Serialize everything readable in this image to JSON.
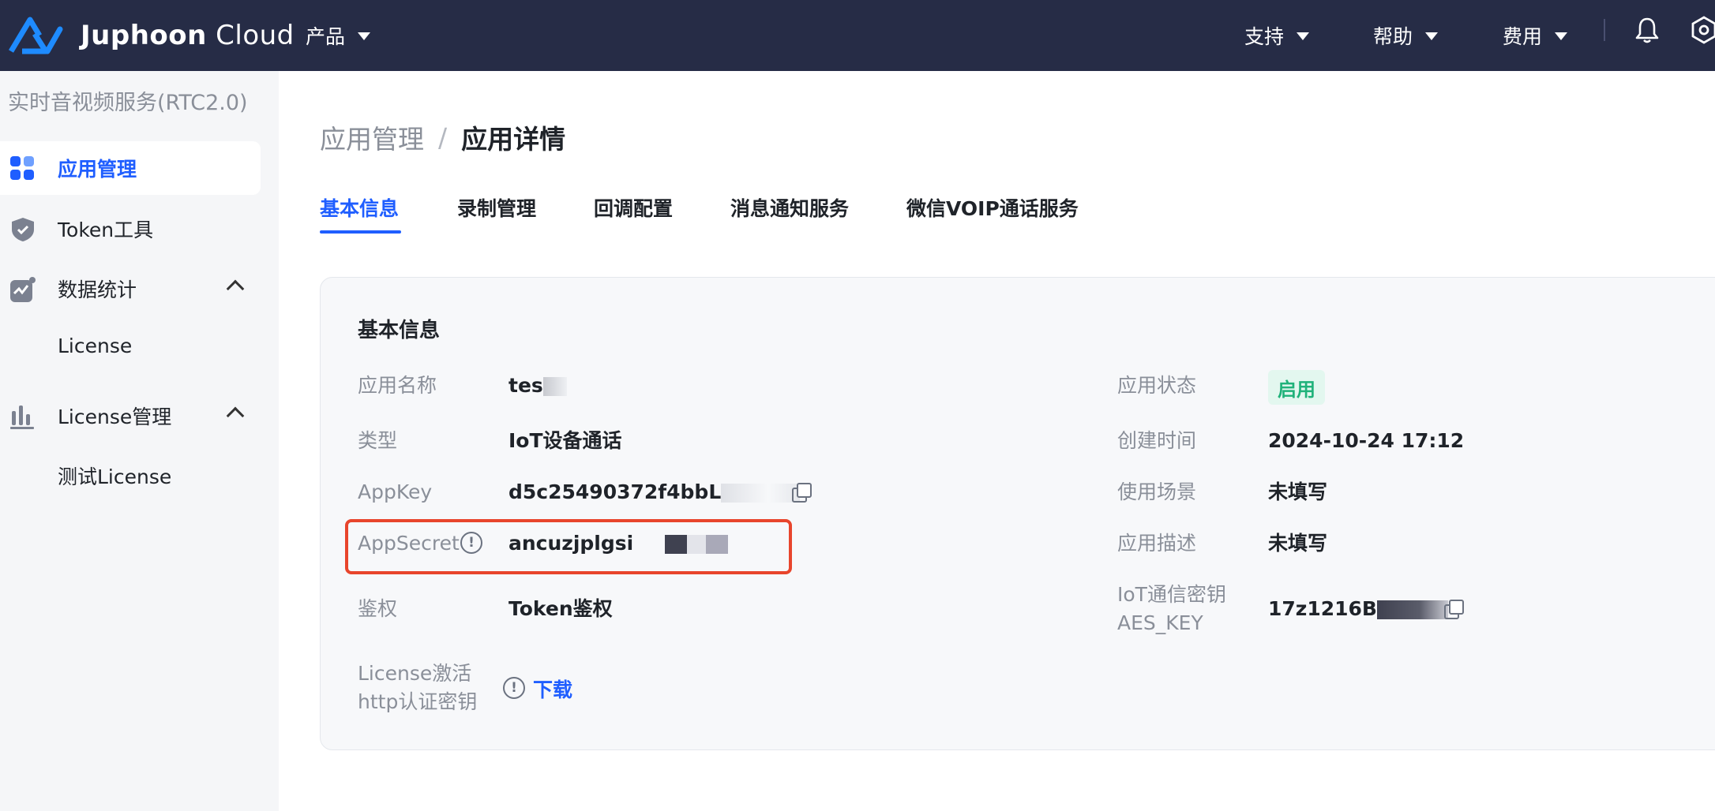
{
  "brand": {
    "name_bold": "Juphoon",
    "name_light": "Cloud",
    "color": "#1e8bff"
  },
  "topnav": {
    "product": "产品",
    "support": "支持",
    "help": "帮助",
    "billing": "费用",
    "bell_icon": "bell-icon",
    "user_icon": "hexagon-icon"
  },
  "sidebar": {
    "service_title": "实时音视频服务(RTC2.0)",
    "items": [
      {
        "label": "应用管理",
        "icon": "apps-icon",
        "active": true
      },
      {
        "label": "Token工具",
        "icon": "shield-icon"
      },
      {
        "label": "数据统计",
        "icon": "stats-icon",
        "expanded": true,
        "children": [
          "License"
        ]
      },
      {
        "label": "License管理",
        "icon": "bar-chart-icon",
        "expanded": true,
        "children": [
          "测试License"
        ]
      }
    ]
  },
  "breadcrumb": {
    "parent": "应用管理",
    "separator": "/",
    "current": "应用详情"
  },
  "tabs": [
    {
      "label": "基本信息",
      "active": true
    },
    {
      "label": "录制管理"
    },
    {
      "label": "回调配置"
    },
    {
      "label": "消息通知服务"
    },
    {
      "label": "微信VOIP通话服务"
    }
  ],
  "basic_info": {
    "title": "基本信息",
    "left": [
      {
        "label": "应用名称",
        "value": "tes"
      },
      {
        "label": "类型",
        "value": "IoT设备通话"
      },
      {
        "label": "AppKey",
        "value": "d5c25490372f4bbL"
      },
      {
        "label": "AppSecret",
        "value": "ancuzjplgsi"
      },
      {
        "label": "鉴权",
        "value": "Token鉴权"
      },
      {
        "label_line1": "License激活",
        "label_line2": "http认证密钥",
        "link": "下载"
      }
    ],
    "right": [
      {
        "label": "应用状态",
        "value": "启用"
      },
      {
        "label": "创建时间",
        "value": "2024-10-24 17:12"
      },
      {
        "label": "使用场景",
        "value": "未填写"
      },
      {
        "label": "应用描述",
        "value": "未填写"
      },
      {
        "label_line1": "IoT通信密钥",
        "label_line2": "AES_KEY",
        "value": "17z1216B"
      }
    ]
  },
  "colors": {
    "nav_bg": "#262c46",
    "accent": "#1f5eff",
    "highlight": "#e8452c",
    "status_green": "#20b27a"
  }
}
